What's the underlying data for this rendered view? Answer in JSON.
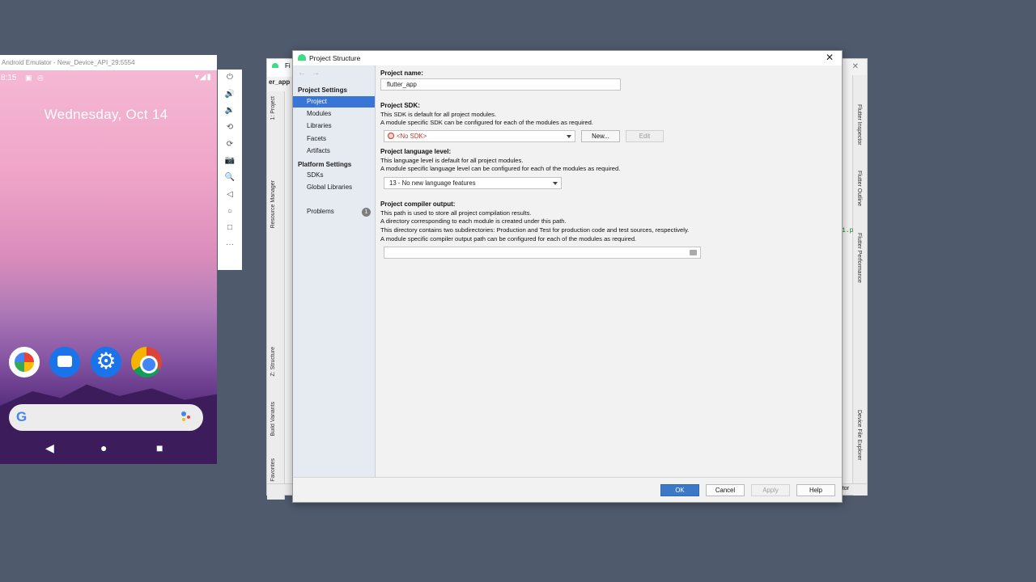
{
  "emulator": {
    "title": "Android Emulator - New_Device_API_29:5554",
    "time": "8:15",
    "date": "Wednesday, Oct 14",
    "search_logo": "G",
    "nav": {
      "back": "◀",
      "home": "●",
      "recents": "■"
    },
    "side_tools": [
      "⏻",
      "🔊",
      "🔉",
      "⟲",
      "⟳",
      "📷",
      "🔍",
      "◁",
      "○",
      "□",
      "···"
    ],
    "apps": [
      "photos",
      "messages",
      "settings",
      "chrome"
    ]
  },
  "studio": {
    "tab_fragment": "Fi",
    "project_label_fragment": "er_app",
    "left_tools": [
      "1: Project",
      "Resource Manager",
      "Z: Structure",
      "Build Variants",
      "2: Favorites"
    ],
    "right_tools": [
      "Flutter Inspector",
      "Flutter Outline",
      "Flutter Performance",
      "Device File Explorer"
    ],
    "code_fragment": "1.p",
    "bottom_fragment": "tor"
  },
  "dialog": {
    "title": "Project Structure",
    "sidebar": {
      "back": "←",
      "forward": "→",
      "project_settings_heading": "Project Settings",
      "project_settings_items": [
        "Project",
        "Modules",
        "Libraries",
        "Facets",
        "Artifacts"
      ],
      "platform_settings_heading": "Platform Settings",
      "platform_settings_items": [
        "SDKs",
        "Global Libraries"
      ],
      "problems_label": "Problems",
      "problems_count": "1",
      "selected": "Project"
    },
    "project_name": {
      "label": "Project name:",
      "value": "flutter_app"
    },
    "project_sdk": {
      "label": "Project SDK:",
      "desc1": "This SDK is default for all project modules.",
      "desc2": "A module specific SDK can be configured for each of the modules as required.",
      "value": "<No SDK>",
      "new_button": "New...",
      "edit_button": "Edit"
    },
    "language_level": {
      "label": "Project language level:",
      "desc1": "This language level is default for all project modules.",
      "desc2": "A module specific language level can be configured for each of the modules as required.",
      "value": "13 - No new language features"
    },
    "compiler_output": {
      "label": "Project compiler output:",
      "desc1": "This path is used to store all project compilation results.",
      "desc2": "A directory corresponding to each module is created under this path.",
      "desc3": "This directory contains two subdirectories: Production and Test for production code and test sources, respectively.",
      "desc4": "A module specific compiler output path can be configured for each of the modules as required.",
      "value": ""
    },
    "footer": {
      "ok": "OK",
      "cancel": "Cancel",
      "apply": "Apply",
      "help": "Help"
    }
  },
  "colors": {
    "accent": "#3875d7",
    "ok_button": "#3c78c6",
    "error_text": "#c0392b",
    "desktop": "#4f5a6c"
  }
}
